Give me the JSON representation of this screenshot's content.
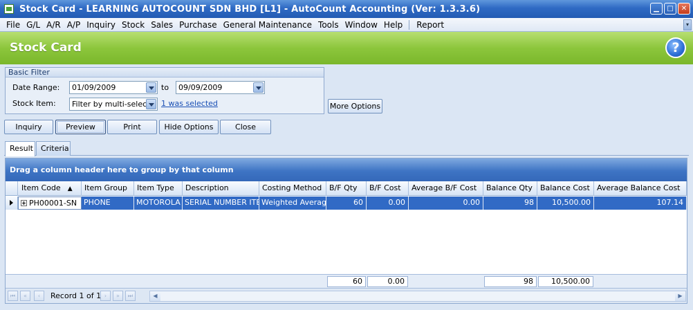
{
  "window": {
    "title": "Stock Card - LEARNING AUTOCOUNT SDN BHD [L1] - AutoCount Accounting (Ver: 1.3.3.6)",
    "min_glyph": "▁",
    "max_glyph": "□",
    "close_glyph": "✕"
  },
  "menu": {
    "items": [
      "File",
      "G/L",
      "A/R",
      "A/P",
      "Inquiry",
      "Stock",
      "Sales",
      "Purchase",
      "General Maintenance",
      "Tools",
      "Window",
      "Help"
    ],
    "report": "Report",
    "end_glyph": "▾"
  },
  "header": {
    "title": "Stock Card",
    "help_glyph": "?"
  },
  "filter": {
    "group_title": "Basic Filter",
    "date_range_label": "Date Range:",
    "date_from": "01/09/2009",
    "to_label": "to",
    "date_to": "09/09/2009",
    "stock_item_label": "Stock Item:",
    "stock_item_value": "Filter by multi-select",
    "selected_link": "1 was selected",
    "more_options": "More Options"
  },
  "actions": {
    "inquiry": "Inquiry",
    "preview": "Preview",
    "print": "Print",
    "hide_options": "Hide Options",
    "close": "Close"
  },
  "tabs": {
    "result": "Result",
    "criteria": "Criteria"
  },
  "grid": {
    "group_hint": "Drag a column header here to group by that column",
    "sort_glyph": "▲",
    "columns": [
      "Item Code",
      "Item Group",
      "Item Type",
      "Description",
      "Costing Method",
      "B/F Qty",
      "B/F Cost",
      "Average B/F Cost",
      "Balance Qty",
      "Balance Cost",
      "Average Balance Cost"
    ],
    "row": {
      "item_code": "PH00001-SN",
      "item_group": "PHONE",
      "item_type": "MOTOROLA",
      "description": "SERIAL NUMBER ITEM",
      "costing_method": "Weighted Average",
      "bf_qty": "60",
      "bf_cost": "0.00",
      "avg_bf_cost": "0.00",
      "balance_qty": "98",
      "balance_cost": "10,500.00",
      "avg_balance_cost": "107.14"
    },
    "totals": {
      "bf_qty": "60",
      "bf_cost": "0.00",
      "balance_qty": "98",
      "balance_cost": "10,500.00"
    },
    "navigator": {
      "record_text": "Record 1 of 1",
      "first_glyph": "⏮",
      "prev_page_glyph": "«",
      "prev_glyph": "‹",
      "next_glyph": "›",
      "next_page_glyph": "»",
      "last_glyph": "⏭",
      "scroll_left_glyph": "◀",
      "scroll_right_glyph": "▶"
    }
  }
}
